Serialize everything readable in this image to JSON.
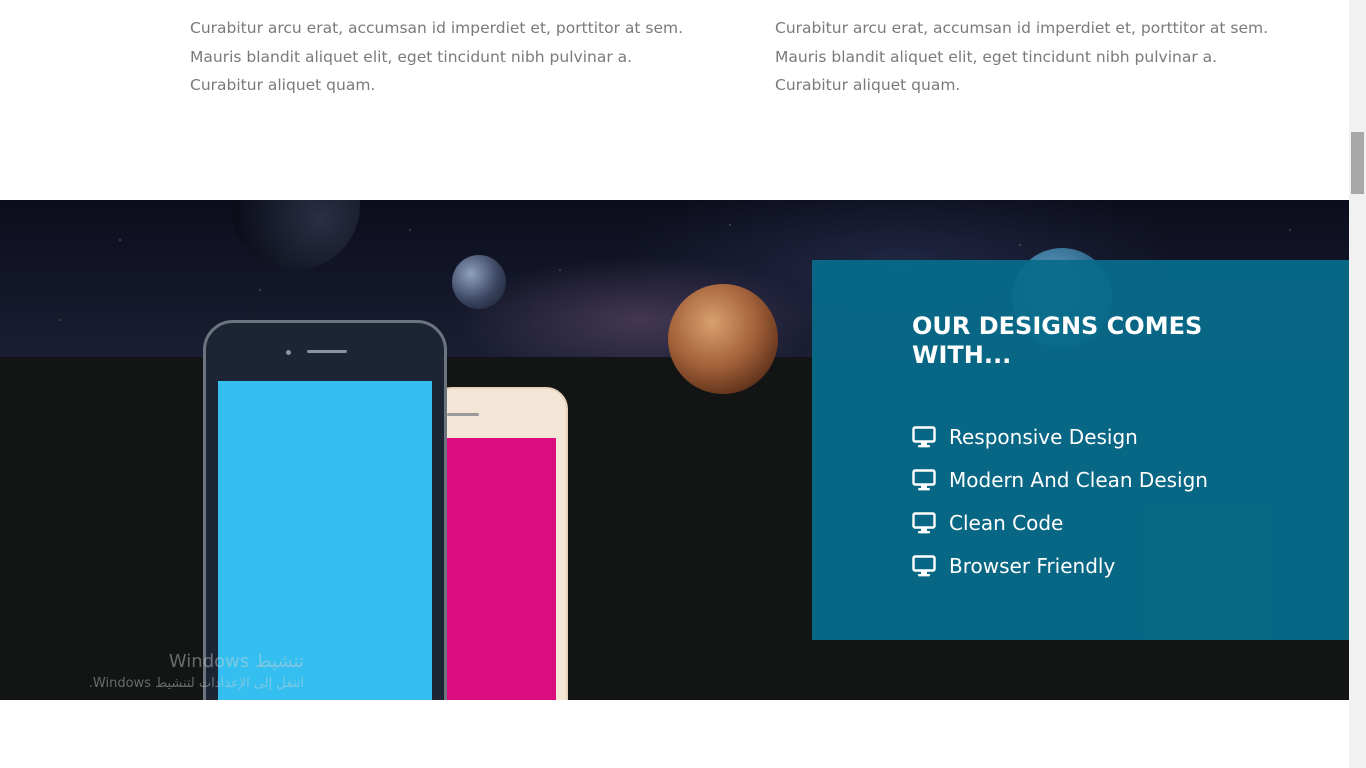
{
  "intro": {
    "left_lines": [
      "Curabitur arcu erat, accumsan id imperdiet et, porttitor at sem.",
      "Mauris blandit aliquet elit, eget tincidunt nibh pulvinar a.",
      "Curabitur aliquet quam."
    ],
    "right_lines": [
      "Curabitur arcu erat, accumsan id imperdiet et, porttitor at sem.",
      "Mauris blandit aliquet elit, eget tincidunt nibh pulvinar a.",
      "Curabitur aliquet quam."
    ]
  },
  "features_panel": {
    "title": "OUR DESIGNS COMES WITH...",
    "items": [
      {
        "icon": "monitor-icon",
        "label": "Responsive Design"
      },
      {
        "icon": "monitor-icon",
        "label": "Modern And Clean Design"
      },
      {
        "icon": "monitor-icon",
        "label": "Clean Code"
      },
      {
        "icon": "monitor-icon",
        "label": "Browser Friendly"
      }
    ]
  },
  "watermark": {
    "title": "تنشيط Windows",
    "subtitle": "انتقل إلى الإعدادات لتنشيط Windows."
  },
  "colors": {
    "panel": "#086c8a",
    "phone_front_screen": "#34bff0",
    "phone_back_screen": "#da0c80",
    "body_text": "#7a7a7a"
  }
}
